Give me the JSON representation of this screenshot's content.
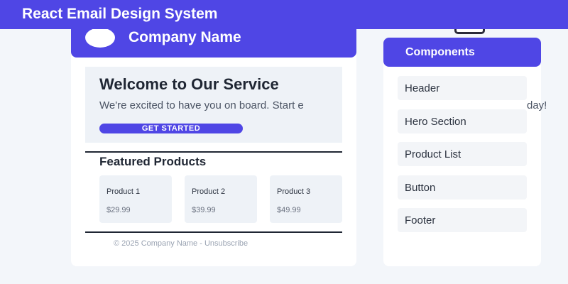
{
  "app": {
    "title": "React Email Design System"
  },
  "email": {
    "header": {
      "company_name": "Company Name",
      "logo_icon": "circle-logo-icon"
    },
    "hero": {
      "title": "Welcome to Our Service",
      "text": "We're excited to have you on board. Start e",
      "text_overflow": "day!",
      "cta_label": "GET STARTED"
    },
    "products": {
      "title": "Featured Products",
      "items": [
        {
          "name": "Product 1",
          "price": "$29.99"
        },
        {
          "name": "Product 2",
          "price": "$39.99"
        },
        {
          "name": "Product 3",
          "price": "$49.99"
        }
      ]
    },
    "footer": {
      "text": "© 2025 Company Name - Unsubscribe"
    }
  },
  "components_panel": {
    "title": "Components",
    "items": [
      {
        "label": "Header"
      },
      {
        "label": "Hero Section"
      },
      {
        "label": "Product List"
      },
      {
        "label": "Button"
      },
      {
        "label": "Footer"
      }
    ]
  },
  "colors": {
    "accent": "#4f46e5",
    "page_bg": "#f3f6fa",
    "card_bg": "#ffffff",
    "section_bg": "#eef2f7",
    "text_dark": "#1f2633",
    "text_muted": "#9aa3b2"
  }
}
